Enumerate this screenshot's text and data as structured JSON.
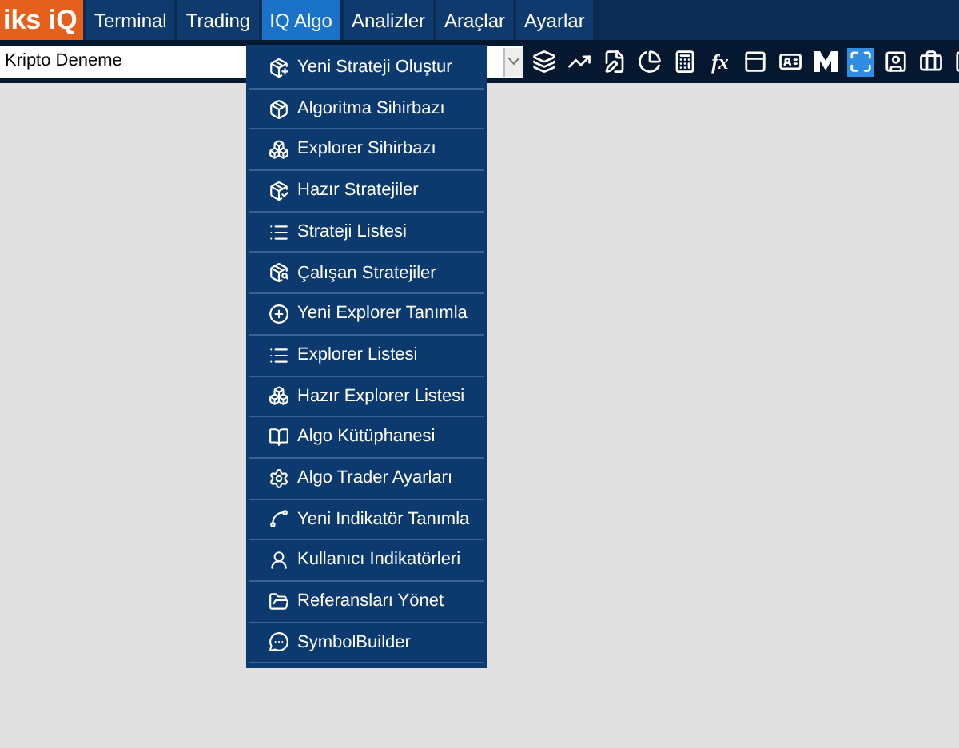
{
  "logo": {
    "text": "iks iQ"
  },
  "menu_bar": [
    {
      "label": "Terminal",
      "selected": false
    },
    {
      "label": "Trading",
      "selected": false
    },
    {
      "label": "IQ Algo",
      "selected": true
    },
    {
      "label": "Analizler",
      "selected": false
    },
    {
      "label": "Araçlar",
      "selected": false
    },
    {
      "label": "Ayarlar",
      "selected": false
    }
  ],
  "workspace_select": {
    "value": "Kripto Deneme"
  },
  "toolbar": [
    {
      "kind": "icon",
      "selected": false
    },
    {
      "kind": "icon",
      "selected": false
    },
    {
      "kind": "icon",
      "selected": false
    },
    {
      "kind": "icon",
      "selected": false
    },
    {
      "kind": "icon",
      "selected": false
    },
    {
      "kind": "text",
      "label": "fx",
      "selected": false
    },
    {
      "kind": "icon",
      "selected": false
    },
    {
      "kind": "icon",
      "selected": false
    },
    {
      "kind": "icon",
      "selected": false
    },
    {
      "kind": "icon",
      "selected": true
    },
    {
      "kind": "icon",
      "selected": false
    },
    {
      "kind": "icon",
      "selected": false
    },
    {
      "kind": "icon",
      "selected": false
    }
  ],
  "dropdown": [
    {
      "label": "Yeni Strateji Oluştur"
    },
    {
      "label": "Algoritma Sihirbazı"
    },
    {
      "label": "Explorer Sihirbazı"
    },
    {
      "label": "Hazır Stratejiler"
    },
    {
      "label": "Strateji Listesi"
    },
    {
      "label": "Çalışan Stratejiler"
    },
    {
      "label": "Yeni Explorer Tanımla"
    },
    {
      "label": "Explorer Listesi"
    },
    {
      "label": "Hazır Explorer Listesi"
    },
    {
      "label": "Algo Kütüphanesi"
    },
    {
      "label": "Algo Trader Ayarları"
    },
    {
      "label": "Yeni Indikatör Tanımla"
    },
    {
      "label": "Kullanıcı Indikatörleri"
    },
    {
      "label": "Referansları Yönet"
    },
    {
      "label": "SymbolBuilder"
    }
  ]
}
